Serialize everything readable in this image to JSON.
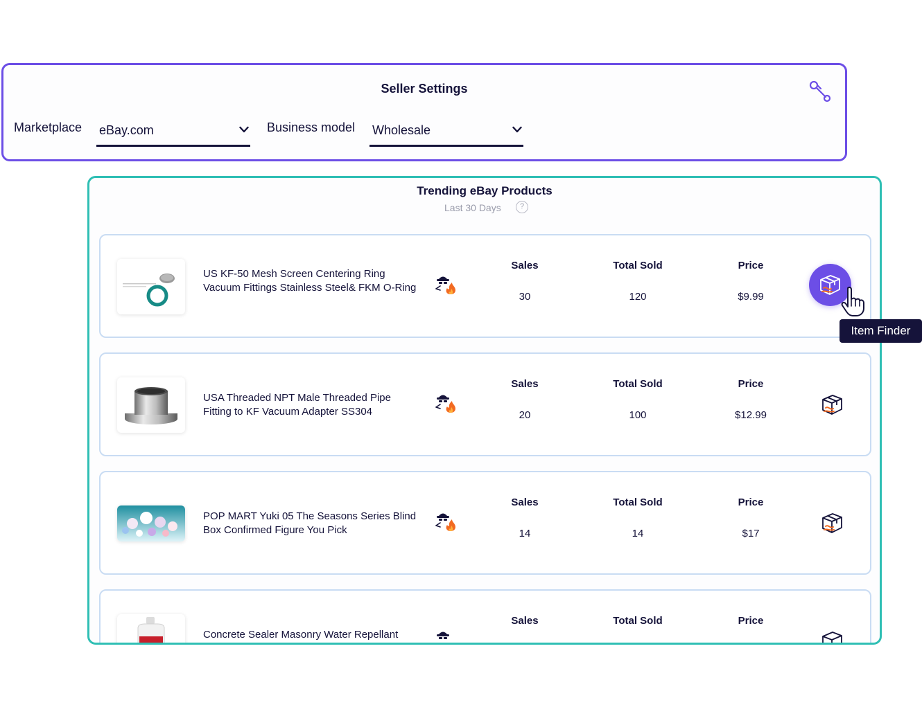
{
  "settings": {
    "title": "Seller Settings",
    "marketplace_label": "Marketplace",
    "marketplace_value": "eBay.com",
    "business_model_label": "Business model",
    "business_model_value": "Wholesale"
  },
  "trending": {
    "title": "Trending eBay Products",
    "subtitle": "Last 30 Days",
    "help": "?",
    "columns": {
      "sales": "Sales",
      "total_sold": "Total Sold",
      "price": "Price"
    },
    "products": [
      {
        "title": "US KF-50 Mesh Screen Centering Ring Vacuum Fittings Stainless Steel& FKM O-Ring",
        "sales": "30",
        "total_sold": "120",
        "price": "$9.99"
      },
      {
        "title": "USA Threaded NPT Male Threaded Pipe Fitting to KF Vacuum Adapter SS304",
        "sales": "20",
        "total_sold": "100",
        "price": "$12.99"
      },
      {
        "title": "POP MART Yuki 05 The Seasons Series Blind Box Confirmed Figure You Pick",
        "sales": "14",
        "total_sold": "14",
        "price": "$17"
      },
      {
        "title": "Concrete Sealer Masonry Water Repellant",
        "sales": "",
        "total_sold": "",
        "price": ""
      }
    ]
  },
  "tooltip": {
    "label": "Item Finder"
  },
  "colors": {
    "accent": "#6c4ee6",
    "teal": "#2fbfb4",
    "fire": "#f26a21",
    "navy": "#15133a"
  },
  "icons": [
    "wrench-icon",
    "chevron-down-icon",
    "help-icon",
    "spy-fire-icon",
    "item-finder-box-icon",
    "hand-cursor-icon"
  ]
}
